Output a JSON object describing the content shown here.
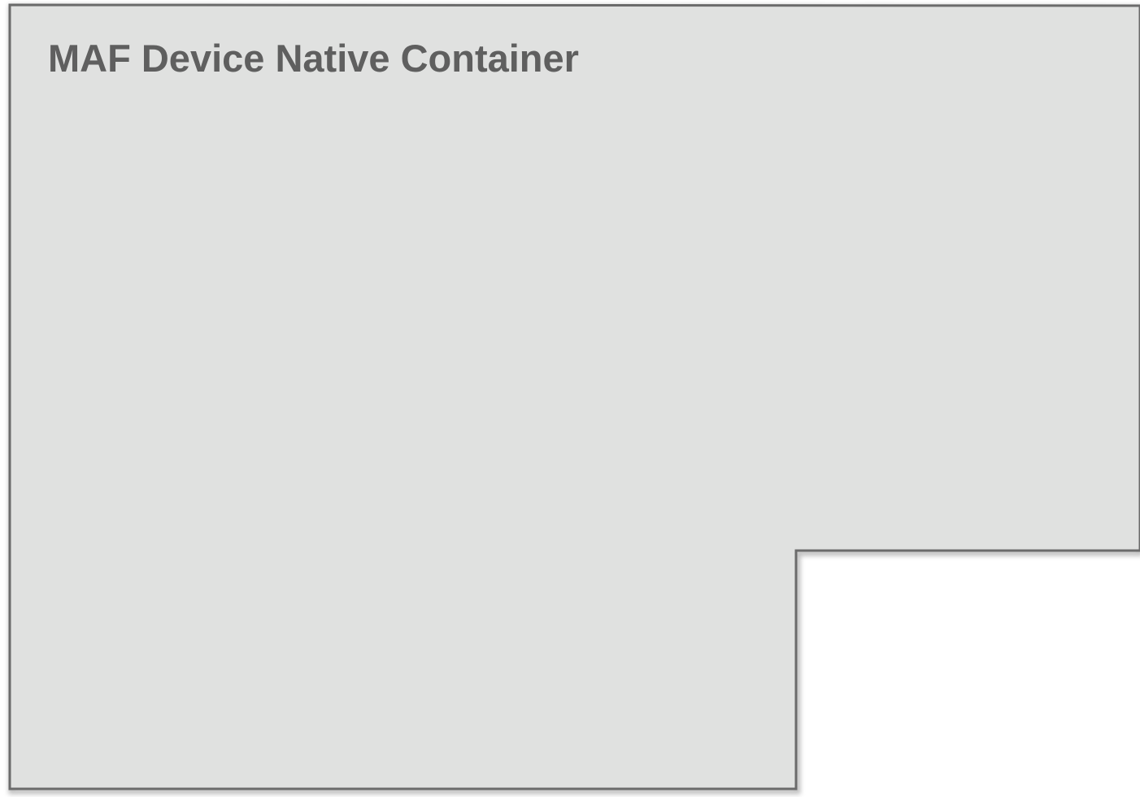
{
  "container": {
    "title": "MAF Device Native Container",
    "fill_color": "#e0e1e0",
    "border_color": "#6b6b6b",
    "title_color": "#5f5f5f"
  }
}
